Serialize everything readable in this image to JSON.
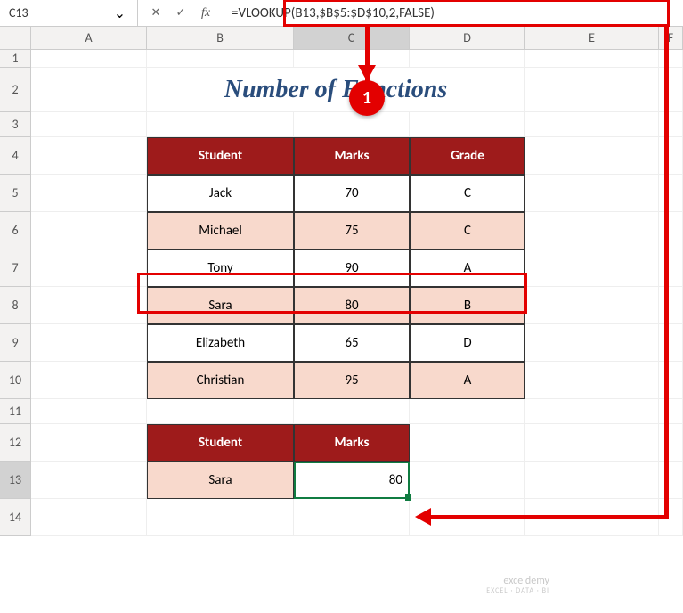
{
  "formula_bar": {
    "cell_ref": "C13",
    "cancel": "✕",
    "confirm": "✓",
    "fx": "fx",
    "dropdown": "⌄",
    "formula": "=VLOOKUP(B13,$B$5:$D$10,2,FALSE)"
  },
  "columns": [
    "A",
    "B",
    "C",
    "D",
    "E",
    "F"
  ],
  "rows": [
    "1",
    "2",
    "3",
    "4",
    "5",
    "6",
    "7",
    "8",
    "9",
    "10",
    "11",
    "12",
    "13",
    "14"
  ],
  "title": "Number of Functions",
  "table1": {
    "headers": [
      "Student",
      "Marks",
      "Grade"
    ],
    "data": [
      {
        "student": "Jack",
        "marks": "70",
        "grade": "C",
        "alt": false
      },
      {
        "student": "Michael",
        "marks": "75",
        "grade": "C",
        "alt": true
      },
      {
        "student": "Tony",
        "marks": "90",
        "grade": "A",
        "alt": false
      },
      {
        "student": "Sara",
        "marks": "80",
        "grade": "B",
        "alt": true
      },
      {
        "student": "Elizabeth",
        "marks": "65",
        "grade": "D",
        "alt": false
      },
      {
        "student": "Christian",
        "marks": "95",
        "grade": "A",
        "alt": true
      }
    ]
  },
  "table2": {
    "headers": [
      "Student",
      "Marks"
    ],
    "data": {
      "student": "Sara",
      "marks": "80"
    }
  },
  "callout": {
    "num": "1"
  },
  "watermark": {
    "brand": "exceldemy",
    "tagline": "EXCEL · DATA · BI"
  }
}
